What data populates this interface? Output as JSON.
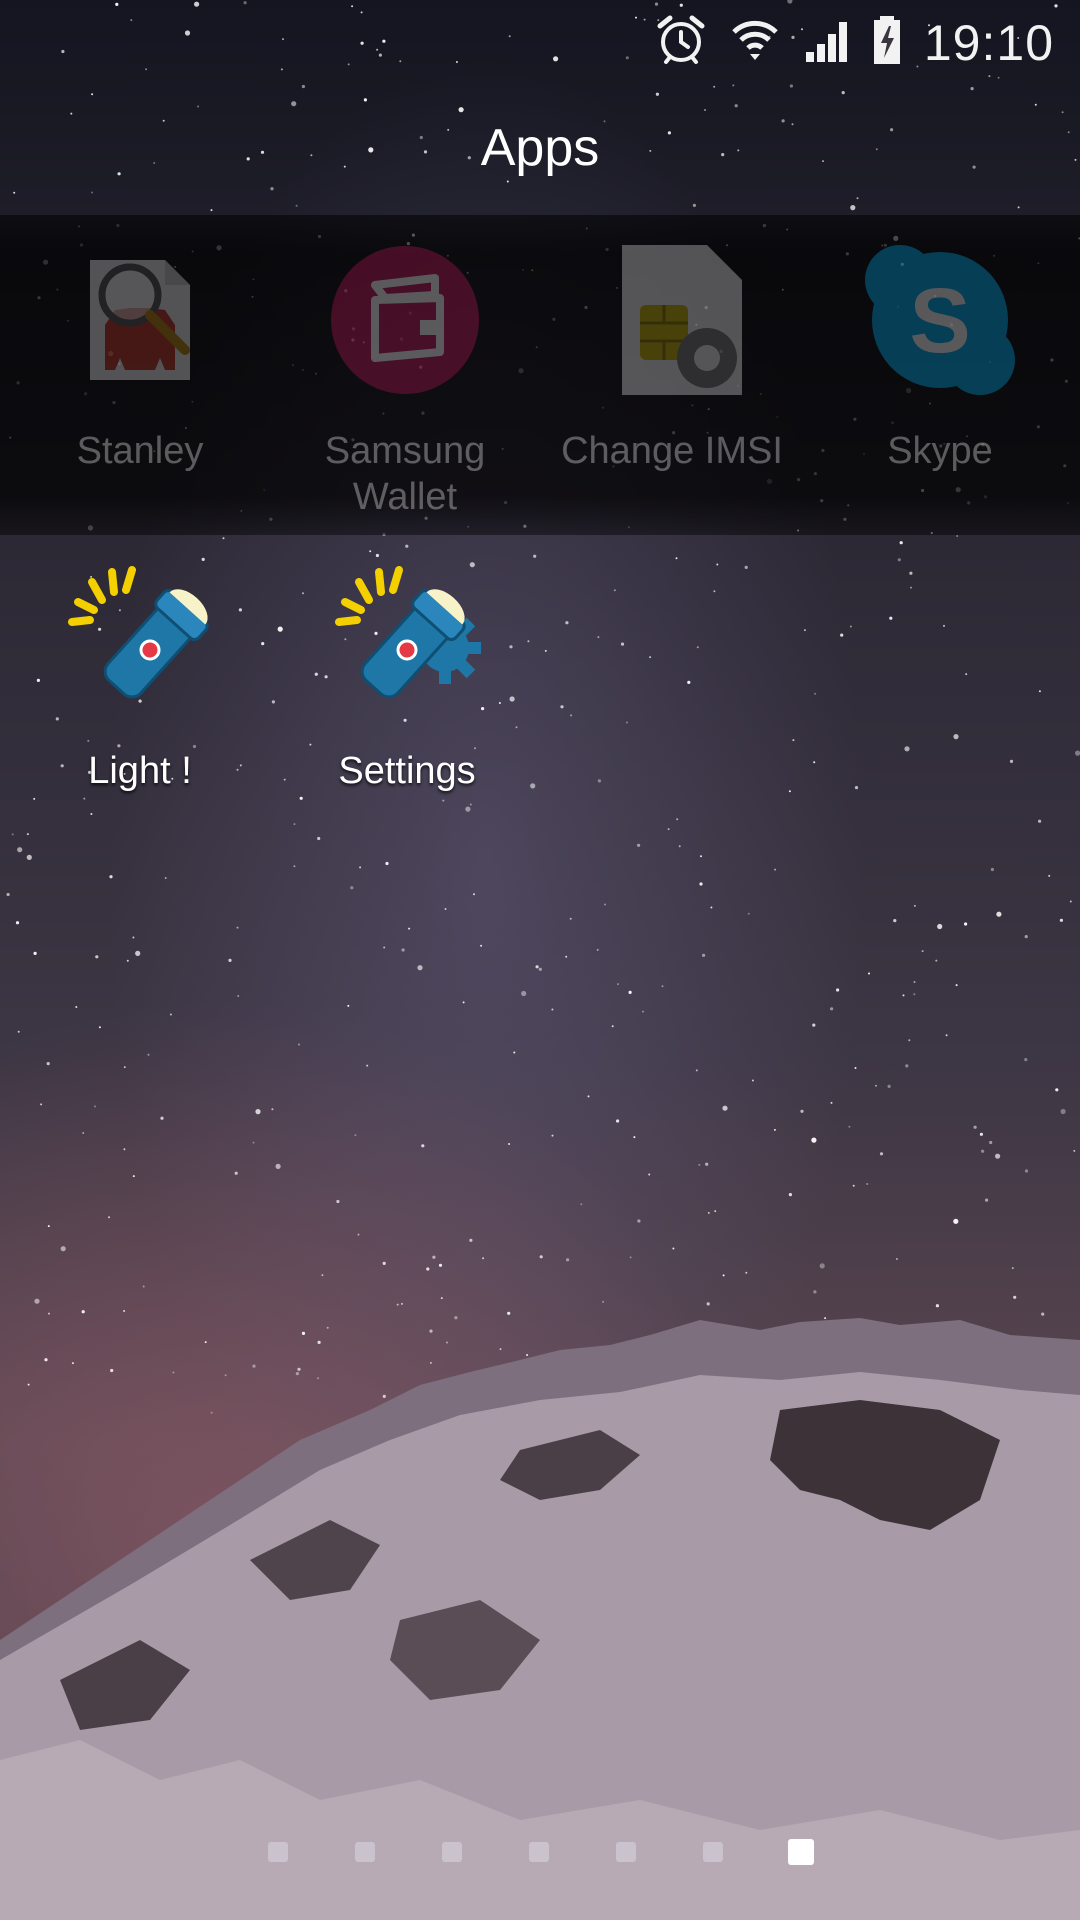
{
  "status_bar": {
    "time": "19:10",
    "icons": [
      "alarm-icon",
      "wifi-icon",
      "signal-icon",
      "battery-charging-icon"
    ]
  },
  "folder": {
    "title": "Apps"
  },
  "apps_dimmed": [
    {
      "label": "Stanley",
      "icon": "stanley-icon"
    },
    {
      "label": "Samsung\nWallet",
      "icon": "samsung-wallet-icon"
    },
    {
      "label": "Change IMSI",
      "icon": "change-imsi-icon"
    },
    {
      "label": "Skype",
      "icon": "skype-icon"
    }
  ],
  "apps": [
    {
      "label": "Light !",
      "icon": "flashlight-icon"
    },
    {
      "label": "Settings",
      "icon": "flashlight-settings-icon"
    }
  ],
  "pager": {
    "pages": 7,
    "active_page": 7
  },
  "colors": {
    "flashlight_blue": "#1f77a8",
    "ray_yellow": "#f5d000",
    "skype_blue": "#00aff0"
  }
}
